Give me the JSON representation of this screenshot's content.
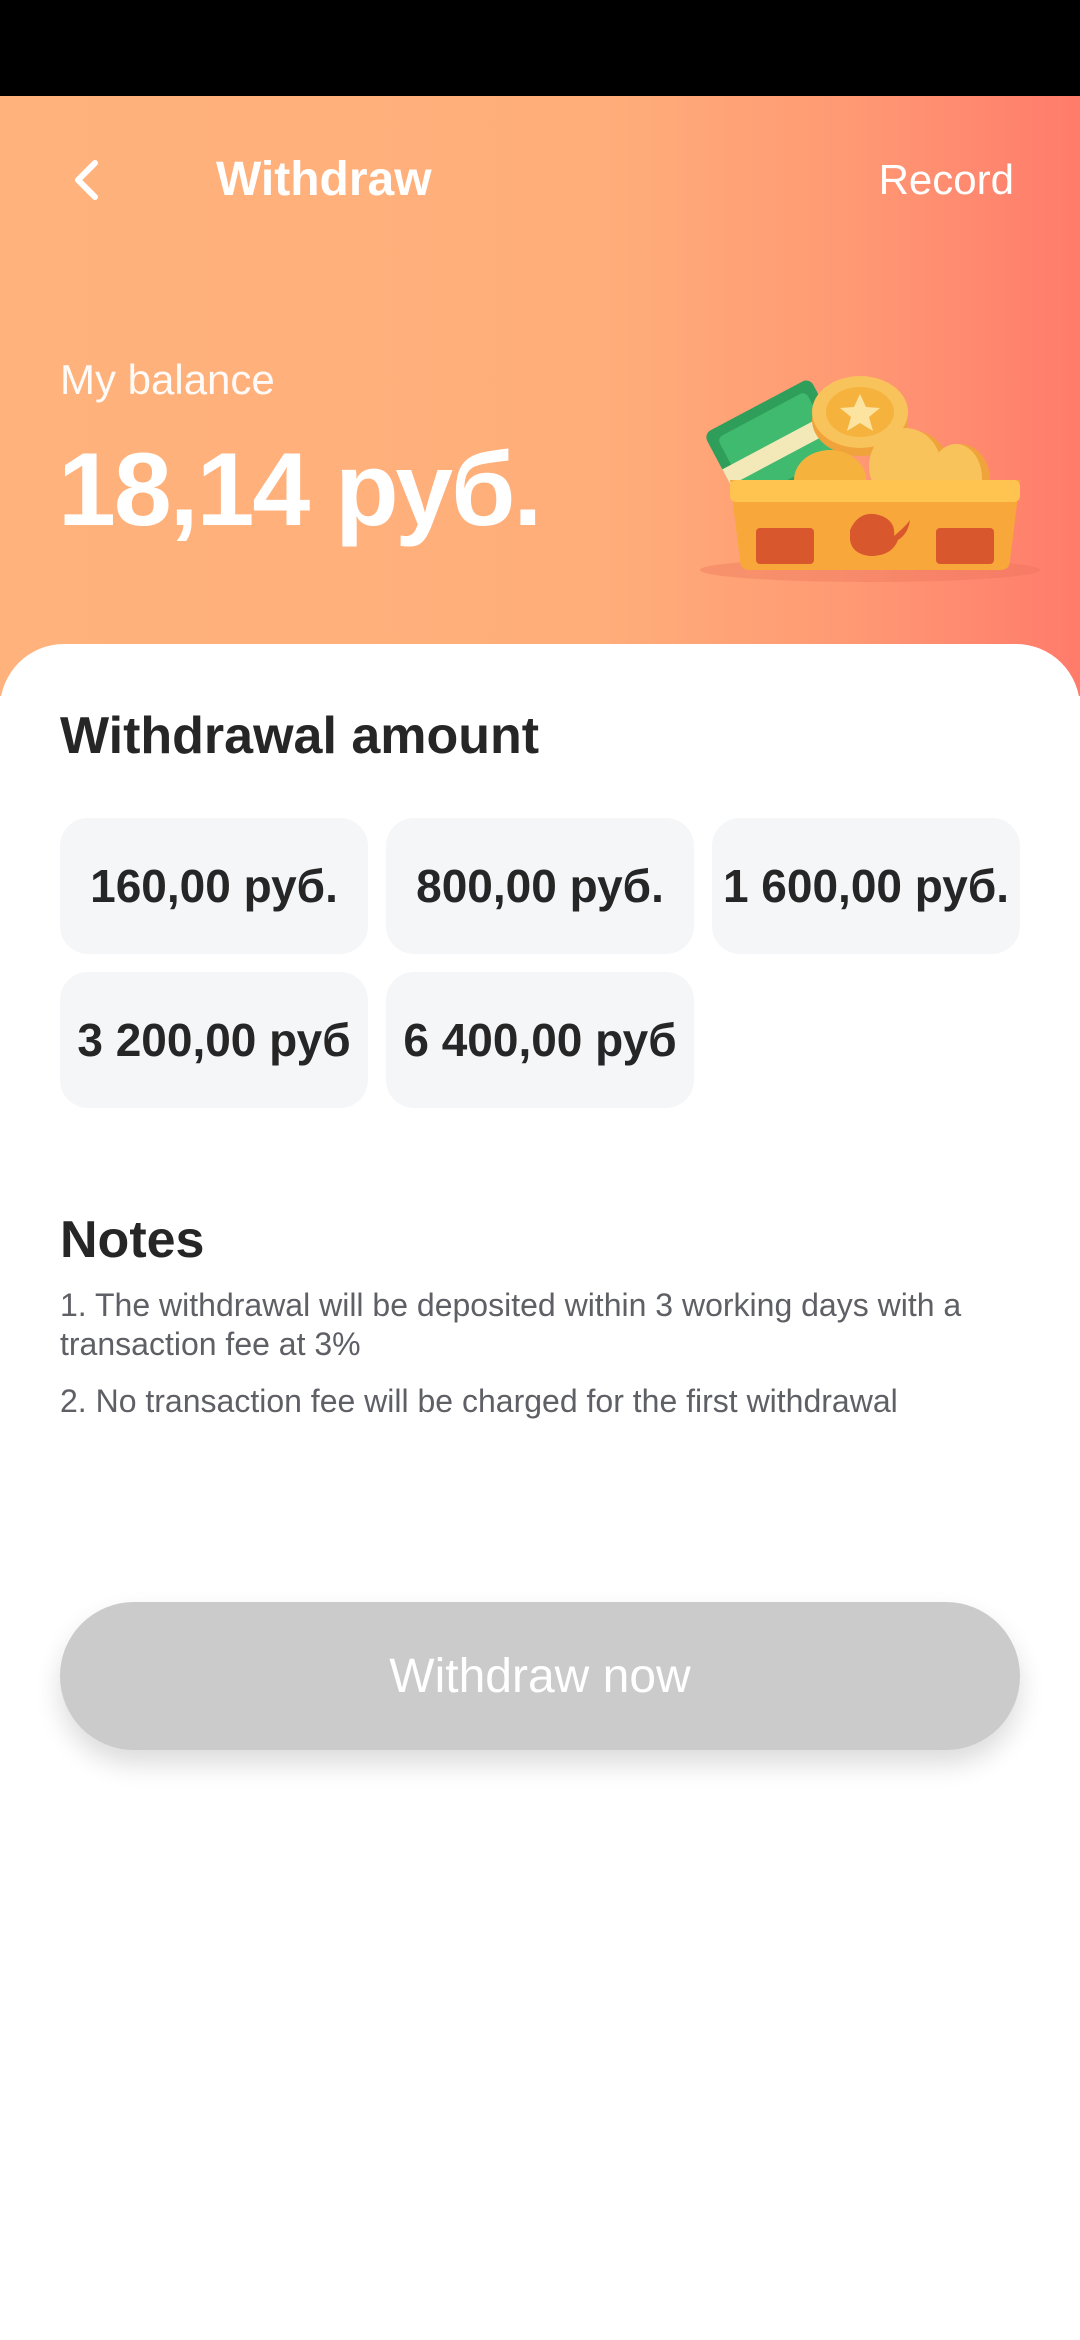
{
  "header": {
    "title": "Withdraw",
    "record_label": "Record",
    "back_icon": "chevron-left-icon"
  },
  "balance": {
    "label": "My balance",
    "value": "18,14 руб."
  },
  "withdrawal": {
    "title": "Withdrawal amount",
    "options": [
      "160,00 руб.",
      "800,00 руб.",
      "1 600,00 руб.",
      "3 200,00 руб",
      "6 400,00 руб"
    ]
  },
  "notes": {
    "title": "Notes",
    "items": [
      "1. The withdrawal will be deposited within 3 working days with a transaction fee at 3%",
      "2. No transaction fee will be charged for the first withdrawal"
    ]
  },
  "action": {
    "withdraw_label": "Withdraw now"
  },
  "colors": {
    "accent_start": "#ffb27c",
    "accent_end": "#ff7b6b",
    "button_disabled": "#cbcbcb"
  }
}
